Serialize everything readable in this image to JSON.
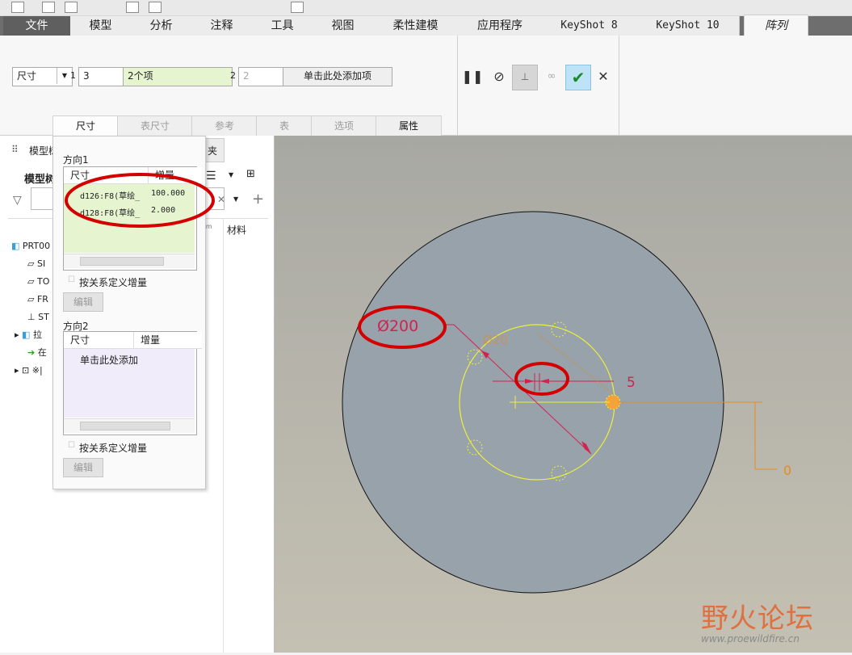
{
  "menu": {
    "tabs": [
      "文件",
      "模型",
      "分析",
      "注释",
      "工具",
      "视图",
      "柔性建模",
      "应用程序",
      "KeyShot 8",
      "KeyShot 10",
      "阵列"
    ]
  },
  "ribbon": {
    "type_select": "尺寸",
    "dir1_label": "1",
    "dir1_count": "3",
    "dir1_items": "2个项",
    "dir2_label": "2",
    "dir2_count": "2",
    "add_item": "单击此处添加项",
    "tabs": [
      "尺寸",
      "表尺寸",
      "参考",
      "表",
      "选项",
      "属性"
    ]
  },
  "left_panel": {
    "title": "模型树",
    "title_short": "模型树",
    "folder_tab": "夹",
    "col_material": "材料",
    "col_param": "am",
    "tree": [
      "PRT00",
      "SI",
      "TO",
      "FR",
      "ST",
      "拉",
      "在",
      "※|"
    ]
  },
  "popup": {
    "dir1_title": "方向1",
    "col_dim": "尺寸",
    "col_inc": "增量",
    "rows": [
      {
        "dim": "d126:F8(草绘_",
        "inc": "100.000"
      },
      {
        "dim": "d128:F8(草绘_",
        "inc": "2.000"
      }
    ],
    "relation": "按关系定义增量",
    "edit": "编辑",
    "dir2_title": "方向2",
    "dir2_hint": "单击此处添加"
  },
  "canvas": {
    "dim_diameter": "Ø200",
    "dim_inner": "Ø20",
    "dim_five": "5",
    "dim_zero": "0"
  },
  "watermark": {
    "title": "野火论坛",
    "url": "www.proewildfire.cn"
  },
  "colors": {
    "accent_red": "#d40000",
    "disc": "#97a2ab",
    "sketch_yellow": "#eef03a",
    "dim_orange": "#e88a1e"
  }
}
